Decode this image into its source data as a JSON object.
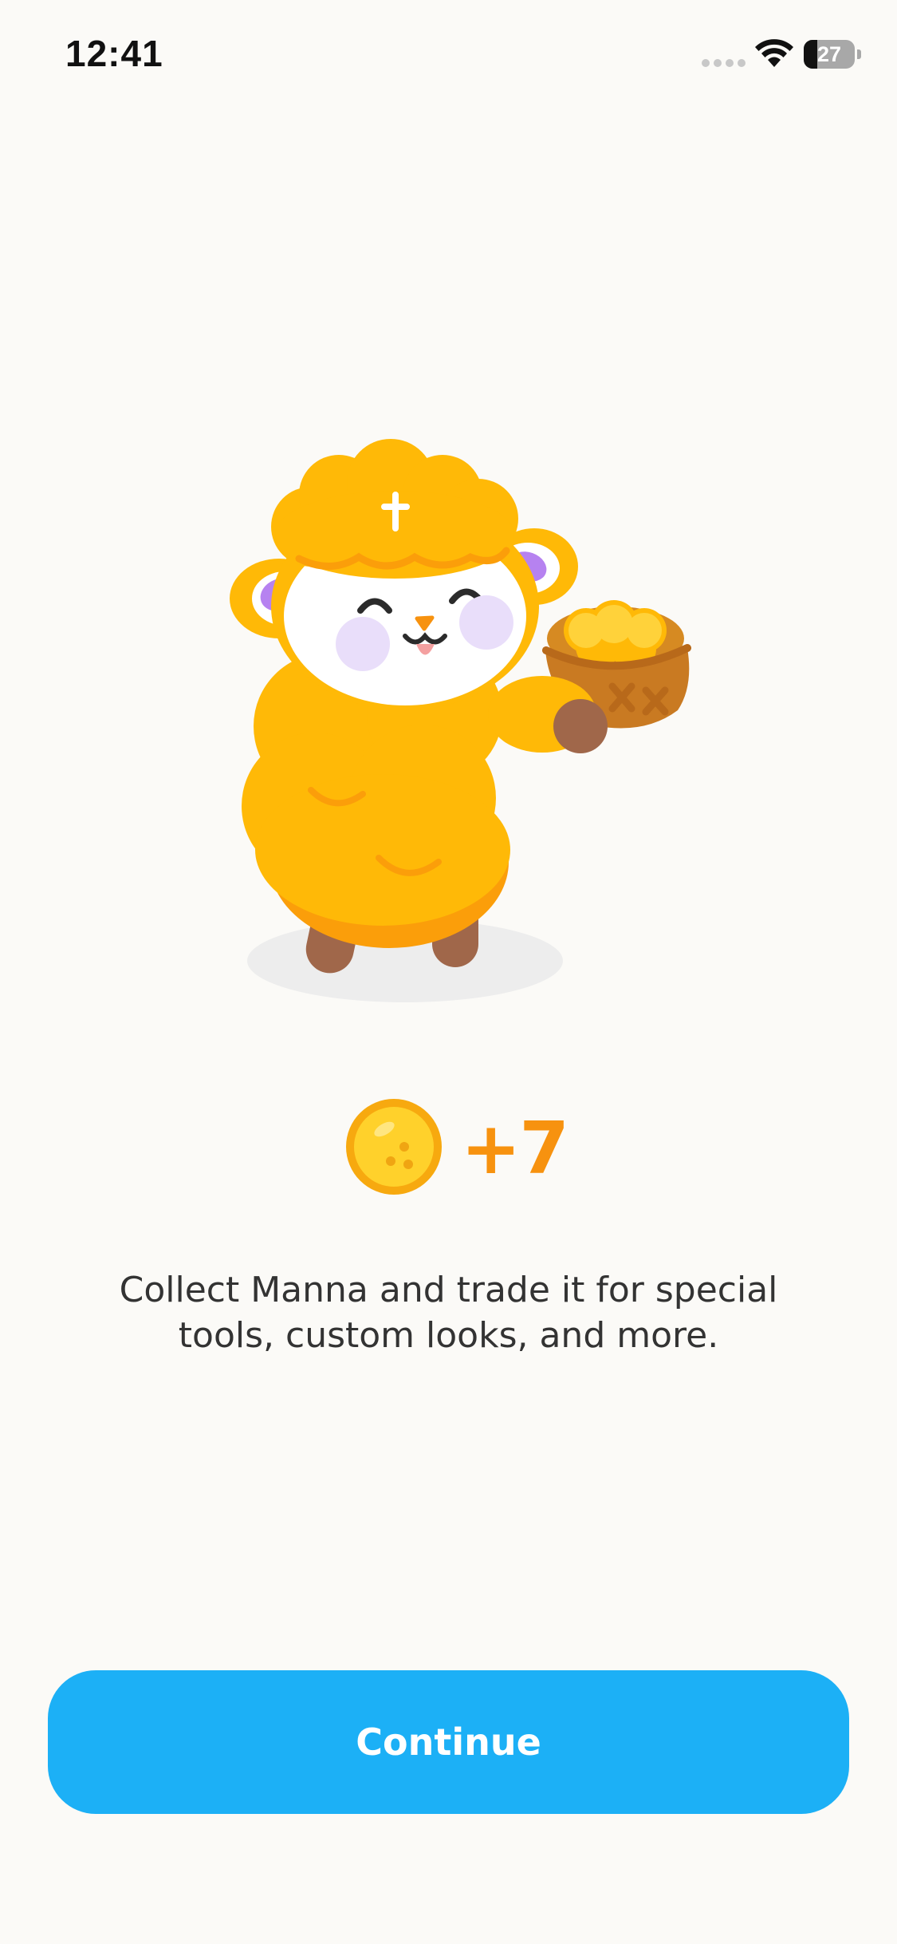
{
  "status_bar": {
    "time": "12:41",
    "battery_level": "27",
    "battery_fraction": 0.27
  },
  "reward": {
    "amount": "+7",
    "currency_icon": "manna-coin-icon"
  },
  "description": "Collect Manna and trade it for special tools, custom looks, and more.",
  "continue_button": {
    "label": "Continue"
  },
  "colors": {
    "background": "#FBFAF7",
    "accent_blue": "#1CB0F6",
    "reward_orange": "#F7920F",
    "sheep_wool": "#FFB907"
  }
}
